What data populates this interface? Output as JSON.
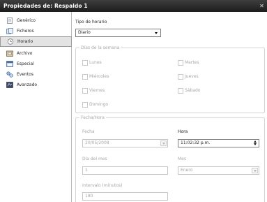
{
  "window": {
    "title": "Propiedades de: Respaldo 1",
    "close_glyph": "✕"
  },
  "nav": {
    "items": [
      {
        "label": "Genérico",
        "icon": "page-icon",
        "color": "#6f7f93"
      },
      {
        "label": "Ficheros",
        "icon": "files-icon",
        "color": "#6f8fb7"
      },
      {
        "label": "Horario",
        "icon": "clock-icon",
        "color": "#8a8a8a",
        "selected": true
      },
      {
        "label": "Archivo",
        "icon": "archive-icon",
        "color": "#7f6f50"
      },
      {
        "label": "Especial",
        "icon": "special-icon",
        "color": "#5e79a6"
      },
      {
        "label": "Eventos",
        "icon": "events-icon",
        "color": "#4a6f9b"
      },
      {
        "label": "Avanzado",
        "icon": "advanced-icon",
        "color": "#3e4e6f"
      }
    ]
  },
  "schedule": {
    "type_label": "Tipo de horario",
    "type_value": "Diario",
    "days_group": {
      "title": "Días de la semana",
      "days": [
        "Lunes",
        "Martes",
        "Miércoles",
        "Jueves",
        "Viernes",
        "Sábado",
        "Domingo"
      ]
    },
    "datetime_group": {
      "title": "Fecha/Hora",
      "date_label": "Fecha",
      "date_value": "20/05/2008",
      "time_label": "Hora",
      "time_value": "11:02:32 p.m.",
      "day_of_month_label": "Día del mes",
      "day_of_month_value": "1",
      "month_label": "Mes",
      "month_value": "Enero",
      "interval_label": "Intervalo (minutos)",
      "interval_value": "180"
    }
  }
}
